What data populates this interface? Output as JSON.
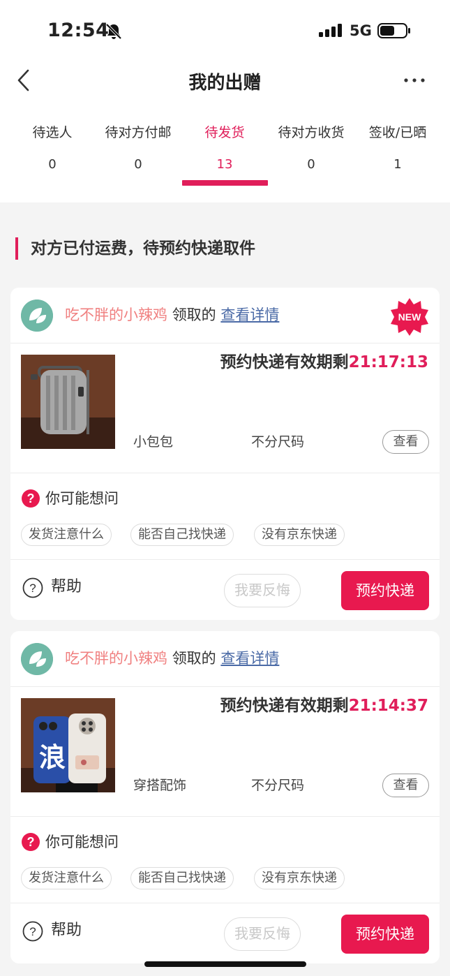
{
  "status": {
    "time": "12:54",
    "network": "5G"
  },
  "nav": {
    "title": "我的出赠"
  },
  "tabs": [
    {
      "label": "待选人",
      "count": "0"
    },
    {
      "label": "待对方付邮",
      "count": "0"
    },
    {
      "label": "待发货",
      "count": "13",
      "active": true
    },
    {
      "label": "待对方收货",
      "count": "0"
    },
    {
      "label": "签收/已晒",
      "count": "1"
    }
  ],
  "section": {
    "title": "对方已付运费，待预约快递取件"
  },
  "cards": [
    {
      "user": "吃不胖的小辣鸡",
      "claim_text": "领取的",
      "detail_link": "查看详情",
      "badge": "NEW",
      "countdown_prefix": "预约快递有效期剩",
      "countdown_time": "21:17:13",
      "category": "小包包",
      "size": "不分尺码",
      "view_label": "查看",
      "faq_title": "你可能想问",
      "chips": [
        "发货注意什么",
        "能否自己找快递",
        "没有京东快递"
      ],
      "help_label": "帮助",
      "regret_label": "我要反悔",
      "book_label": "预约快递"
    },
    {
      "user": "吃不胖的小辣鸡",
      "claim_text": "领取的",
      "detail_link": "查看详情",
      "countdown_prefix": "预约快递有效期剩",
      "countdown_time": "21:14:37",
      "category": "穿搭配饰",
      "size": "不分尺码",
      "view_label": "查看",
      "faq_title": "你可能想问",
      "chips": [
        "发货注意什么",
        "能否自己找快递",
        "没有京东快递"
      ],
      "help_label": "帮助",
      "regret_label": "我要反悔",
      "book_label": "预约快递",
      "image_text": "浪"
    }
  ],
  "colors": {
    "accent": "#e01e5a",
    "button": "#e8194f",
    "username": "#f08080",
    "link": "#4a6aa6"
  }
}
